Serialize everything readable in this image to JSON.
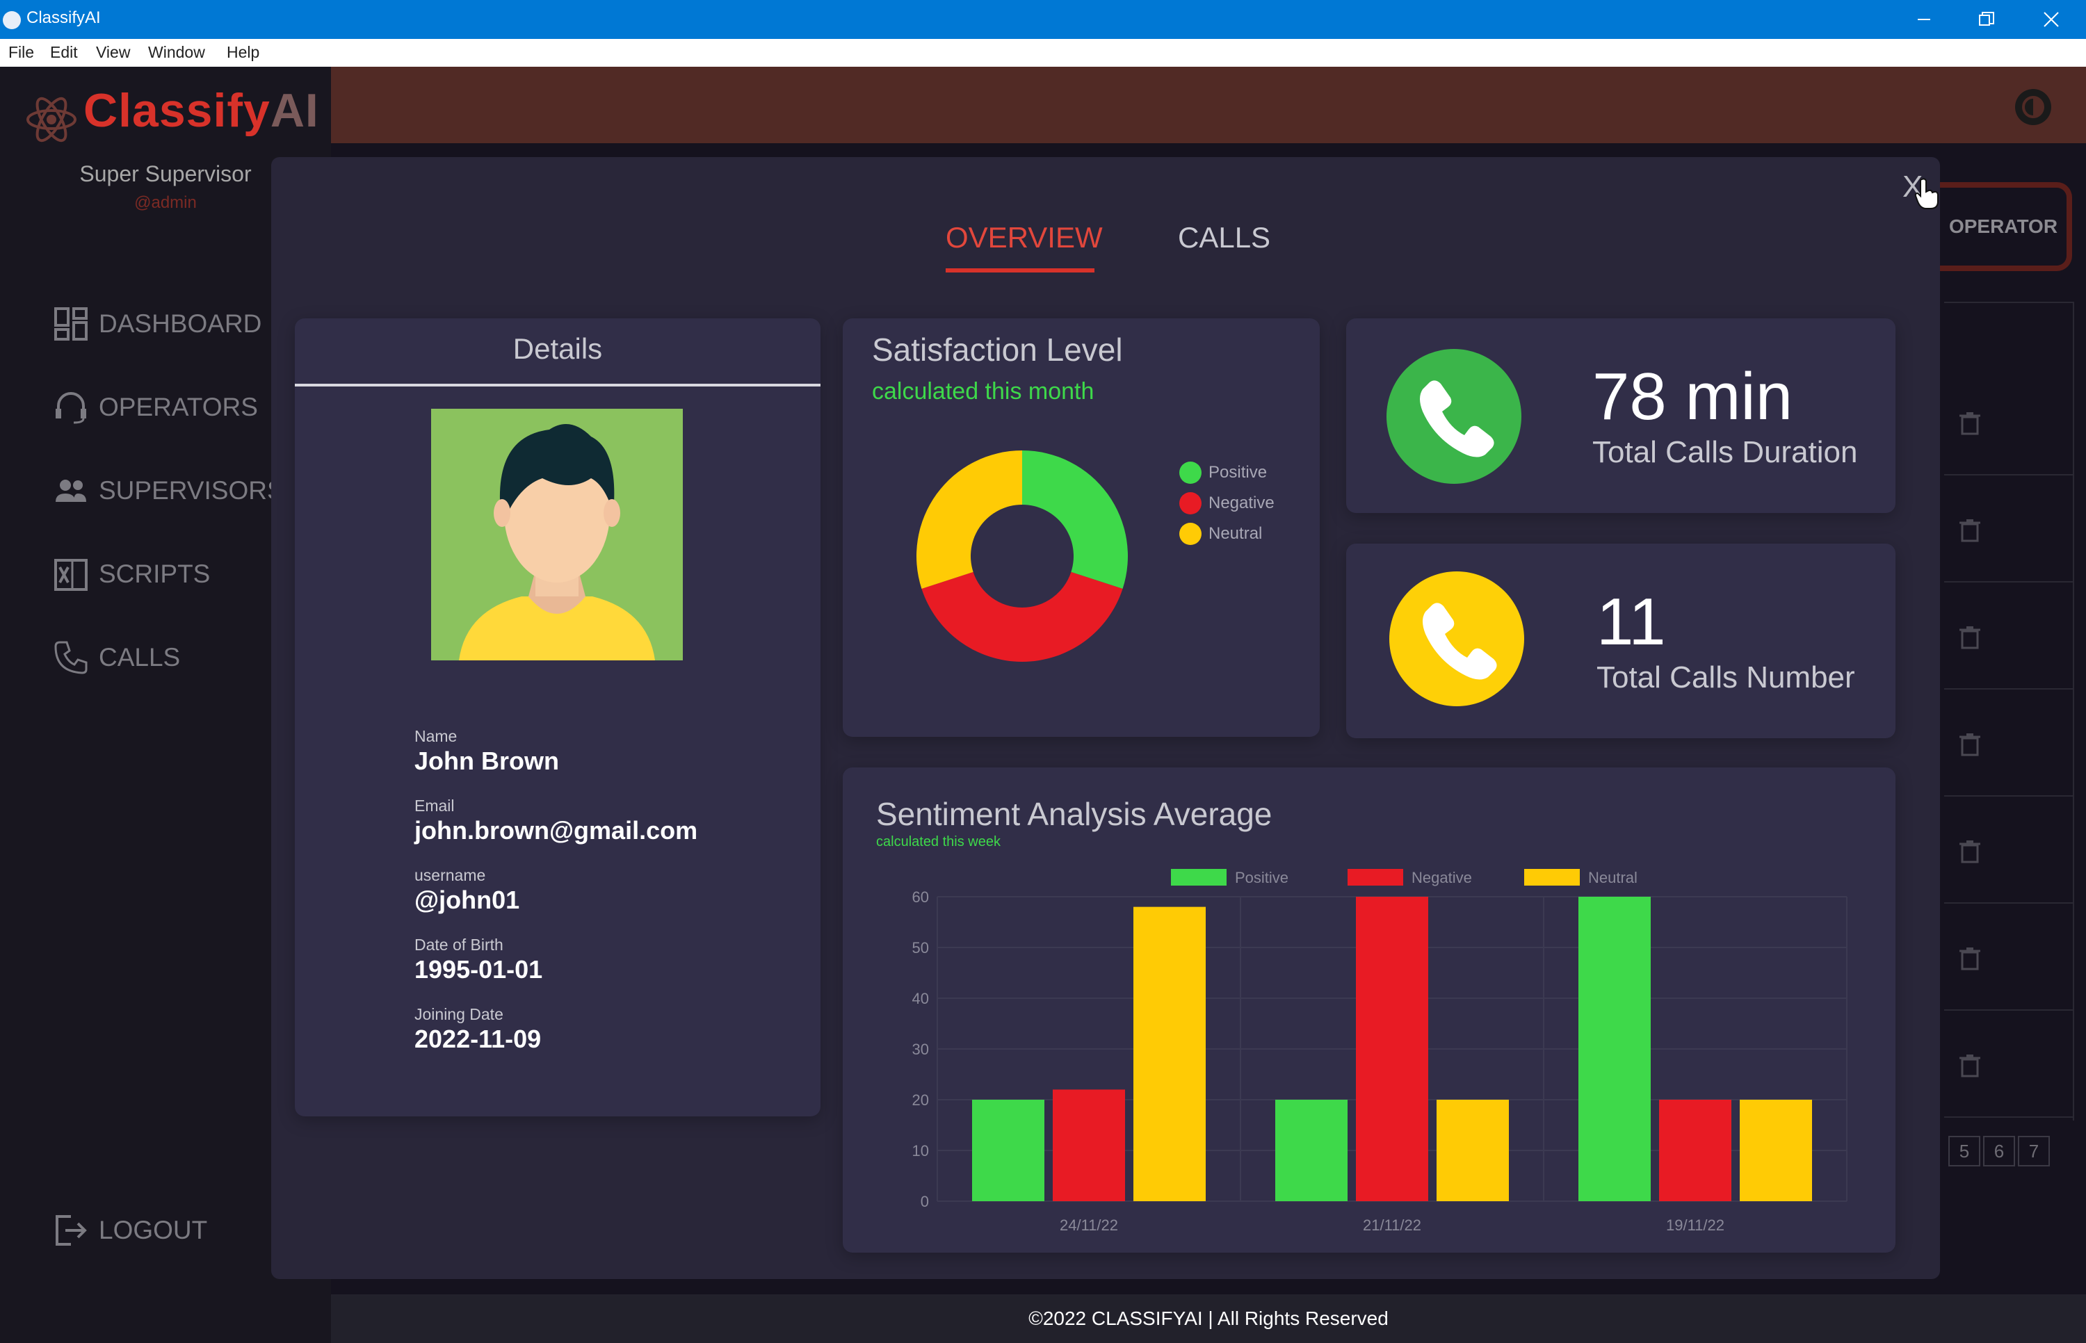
{
  "window": {
    "title": "ClassifyAI",
    "menu": [
      "File",
      "Edit",
      "View",
      "Window",
      "Help"
    ]
  },
  "sidebar": {
    "brand_a": "Classify",
    "brand_b": "AI",
    "role": "Super Supervisor",
    "handle": "@admin",
    "items": [
      {
        "label": "DASHBOARD",
        "icon": "dashboard-icon"
      },
      {
        "label": "OPERATORS",
        "icon": "headset-icon"
      },
      {
        "label": "SUPERVISORS",
        "icon": "users-icon"
      },
      {
        "label": "SCRIPTS",
        "icon": "excel-file-icon"
      },
      {
        "label": "CALLS",
        "icon": "phone-icon"
      }
    ],
    "logout": "LOGOUT"
  },
  "background": {
    "operator_button": "OPERATOR",
    "pages": [
      "5",
      "6",
      "7"
    ]
  },
  "modal": {
    "close_label": "X",
    "tabs": [
      {
        "label": "OVERVIEW",
        "active": true
      },
      {
        "label": "CALLS",
        "active": false
      }
    ],
    "details": {
      "title": "Details",
      "fields": [
        {
          "label": "Name",
          "value": "John Brown"
        },
        {
          "label": "Email",
          "value": "john.brown@gmail.com"
        },
        {
          "label": "username",
          "value": "@john01"
        },
        {
          "label": "Date of Birth",
          "value": "1995-01-01"
        },
        {
          "label": "Joining Date",
          "value": "2022-11-09"
        }
      ]
    },
    "satisfaction": {
      "title": "Satisfaction Level",
      "subtitle": "calculated this month"
    },
    "duration": {
      "value": "78 min",
      "label": "Total Calls Duration"
    },
    "count": {
      "value": "11",
      "label": "Total Calls Number"
    },
    "sentiment": {
      "title": "Sentiment Analysis Average",
      "subtitle": "calculated this week"
    }
  },
  "footer": "©2022 CLASSIFYAI | All Rights Reserved",
  "colors": {
    "accent_red": "#d8322a",
    "positive": "#3ed94a",
    "negative": "#e81b24",
    "neutral": "#ffcb05",
    "modal_bg": "#292639",
    "card_bg": "#312e48"
  },
  "chart_data": [
    {
      "type": "pie",
      "categories": [
        "Positive",
        "Negative",
        "Neutral"
      ],
      "values": [
        30,
        40,
        30
      ],
      "legend": "right"
    },
    {
      "type": "bar",
      "categories": [
        "24/11/22",
        "21/11/22",
        "19/11/22"
      ],
      "series": [
        {
          "name": "Positive",
          "values": [
            20,
            20,
            60
          ]
        },
        {
          "name": "Negative",
          "values": [
            22,
            60,
            20
          ]
        },
        {
          "name": "Neutral",
          "values": [
            58,
            20,
            20
          ]
        }
      ],
      "ylim": [
        0,
        60
      ],
      "yticks": [
        0,
        10,
        20,
        30,
        40,
        50,
        60
      ],
      "legend": "top",
      "grid": true
    }
  ]
}
